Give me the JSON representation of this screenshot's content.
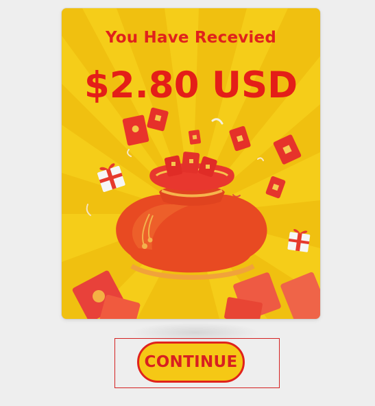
{
  "reward": {
    "headline": "You Have Recevied",
    "amount": "$2.80 USD"
  },
  "actions": {
    "continue_label": "CONTINUE"
  },
  "colors": {
    "card_background": "#f0c010",
    "accent_red": "#e0221c",
    "button_fill": "#f5c815"
  }
}
